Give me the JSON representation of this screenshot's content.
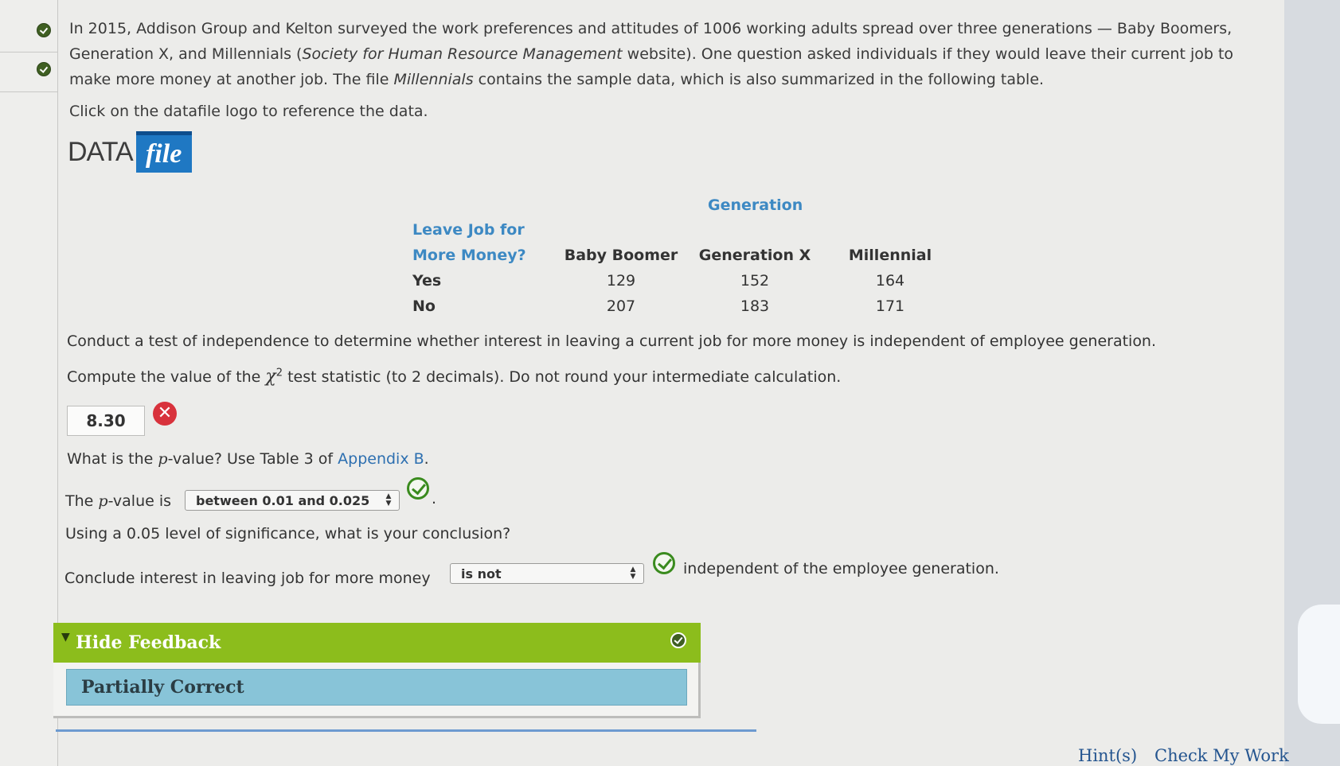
{
  "intro": {
    "part1": "In 2015, Addison Group and Kelton surveyed the work preferences and attitudes of 1006 working adults spread over three generations — Baby Boomers, Generation X, and Millennials (",
    "source": "Society for Human Resource Management",
    "part2": " website). One question asked individuals if they would leave their current job to make more money at another job. The file ",
    "filename": "Millennials",
    "part3": " contains the sample data, which is also summarized in the following table."
  },
  "click_line": "Click on the datafile logo to reference the data.",
  "datafile": {
    "data_word": "DATA",
    "file_word": "file"
  },
  "table": {
    "group_header": "Generation",
    "row_header_line1": "Leave Job for",
    "row_header_line2": "More Money?",
    "columns": [
      "Baby Boomer",
      "Generation X",
      "Millennial"
    ],
    "rows": [
      {
        "label": "Yes",
        "values": [
          "129",
          "152",
          "164"
        ]
      },
      {
        "label": "No",
        "values": [
          "207",
          "183",
          "171"
        ]
      }
    ]
  },
  "question1": "Conduct a test of independence to determine whether interest in leaving a current job for more money is independent of employee generation.",
  "question2": {
    "before": "Compute the value of the ",
    "symbol": "χ",
    "superscript": "2",
    "after": " test statistic (to 2 decimals). Do not round your intermediate calculation."
  },
  "answer_chi": "8.30",
  "question3": {
    "before": "What is the ",
    "p": "p",
    "middle": "-value? Use Table 3 of ",
    "link": "Appendix B",
    "end": "."
  },
  "pvalue_line": {
    "before": "The ",
    "p": "p",
    "after": "-value is",
    "selected": "between 0.01 and 0.025",
    "end": "."
  },
  "question4": "Using a 0.05 level of significance, what is your conclusion?",
  "conclude_line": {
    "before": "Conclude interest in leaving job for more money",
    "selected": "is not",
    "after": "independent of the employee generation."
  },
  "feedback": {
    "title": "Hide Feedback",
    "result": "Partially Correct"
  },
  "footer": {
    "hints": "Hint(s)",
    "check": "Check My Work"
  },
  "colors": {
    "feedback_green": "#8cbd1c",
    "result_blue": "#88c4d8",
    "error_red": "#d8323c",
    "correct_green": "#3a8b1e",
    "header_blue": "#3d89c3"
  }
}
